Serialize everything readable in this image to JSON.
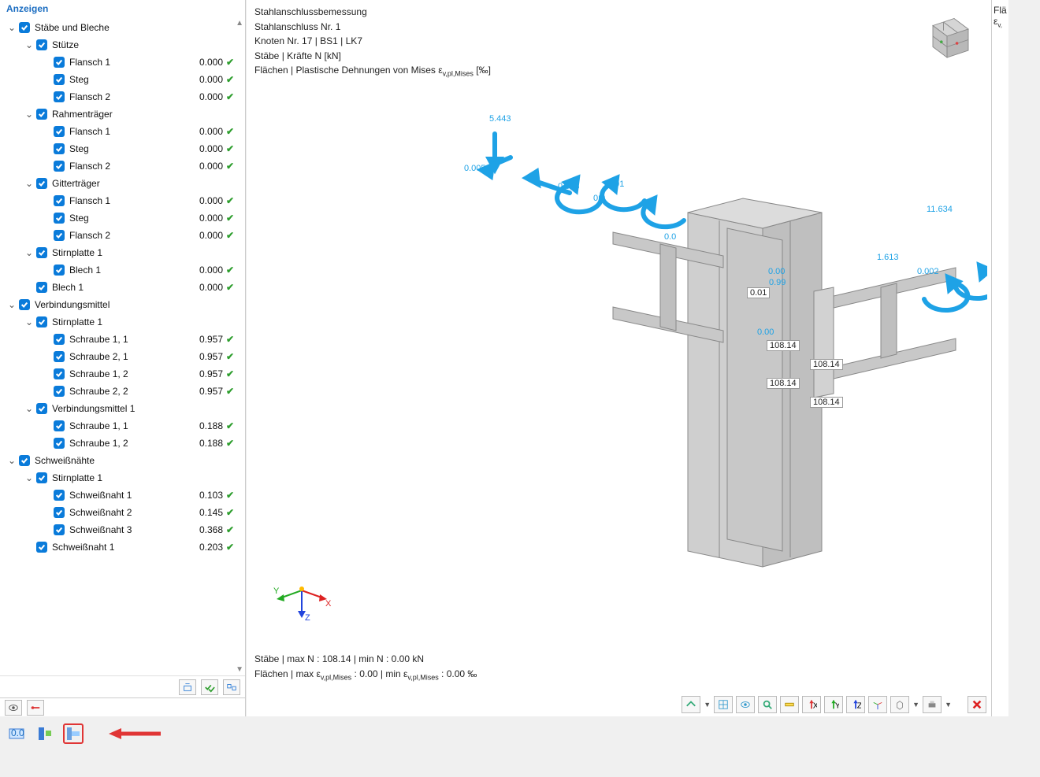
{
  "sidebar": {
    "title": "Anzeigen",
    "toolbar": {
      "btn1": "expand-selected",
      "btn2": "check-all",
      "btn3": "uncheck-all"
    },
    "tabs": {
      "eye": "visibility-tab",
      "line": "filter-tab"
    }
  },
  "tree": {
    "n0": {
      "chev": "⌄",
      "ind": 0,
      "label": "Stäbe und Bleche"
    },
    "n1": {
      "chev": "⌄",
      "ind": 1,
      "label": "Stütze"
    },
    "n2": {
      "ind": 2,
      "label": "Flansch 1",
      "val": "0.000"
    },
    "n3": {
      "ind": 2,
      "label": "Steg",
      "val": "0.000"
    },
    "n4": {
      "ind": 2,
      "label": "Flansch 2",
      "val": "0.000"
    },
    "n5": {
      "chev": "⌄",
      "ind": 1,
      "label": "Rahmenträger"
    },
    "n6": {
      "ind": 2,
      "label": "Flansch 1",
      "val": "0.000"
    },
    "n7": {
      "ind": 2,
      "label": "Steg",
      "val": "0.000"
    },
    "n8": {
      "ind": 2,
      "label": "Flansch 2",
      "val": "0.000"
    },
    "n9": {
      "chev": "⌄",
      "ind": 1,
      "label": "Gitterträger"
    },
    "n10": {
      "ind": 2,
      "label": "Flansch 1",
      "val": "0.000"
    },
    "n11": {
      "ind": 2,
      "label": "Steg",
      "val": "0.000"
    },
    "n12": {
      "ind": 2,
      "label": "Flansch 2",
      "val": "0.000"
    },
    "n13": {
      "chev": "⌄",
      "ind": 1,
      "label": "Stirnplatte 1"
    },
    "n14": {
      "ind": 2,
      "label": "Blech 1",
      "val": "0.000"
    },
    "n15": {
      "ind": 1,
      "label": "Blech 1",
      "val": "0.000"
    },
    "n16": {
      "chev": "⌄",
      "ind": 0,
      "label": "Verbindungsmittel"
    },
    "n17": {
      "chev": "⌄",
      "ind": 1,
      "label": "Stirnplatte 1"
    },
    "n18": {
      "ind": 2,
      "label": "Schraube 1, 1",
      "val": "0.957"
    },
    "n19": {
      "ind": 2,
      "label": "Schraube 2, 1",
      "val": "0.957"
    },
    "n20": {
      "ind": 2,
      "label": "Schraube 1, 2",
      "val": "0.957"
    },
    "n21": {
      "ind": 2,
      "label": "Schraube 2, 2",
      "val": "0.957"
    },
    "n22": {
      "chev": "⌄",
      "ind": 1,
      "label": "Verbindungsmittel 1"
    },
    "n23": {
      "ind": 2,
      "label": "Schraube 1, 1",
      "val": "0.188"
    },
    "n24": {
      "ind": 2,
      "label": "Schraube 1, 2",
      "val": "0.188"
    },
    "n25": {
      "chev": "⌄",
      "ind": 0,
      "label": "Schweißnähte"
    },
    "n26": {
      "chev": "⌄",
      "ind": 1,
      "label": "Stirnplatte 1"
    },
    "n27": {
      "ind": 2,
      "label": "Schweißnaht 1",
      "val": "0.103"
    },
    "n28": {
      "ind": 2,
      "label": "Schweißnaht 2",
      "val": "0.145"
    },
    "n29": {
      "ind": 2,
      "label": "Schweißnaht 3",
      "val": "0.368"
    },
    "n30": {
      "ind": 1,
      "label": "Schweißnaht 1",
      "val": "0.203"
    }
  },
  "viewport": {
    "info1": "Stahlanschlussbemessung",
    "info2": "Stahlanschluss Nr. 1",
    "info3": "Knoten Nr. 17 | BS1 | LK7",
    "info4": "Stäbe | Kräfte N [kN]",
    "info5_a": "Flächen | Plastische Dehnungen von Mises ε",
    "info5_sub": "v,pl,Mises",
    "info5_b": " [‰]",
    "bot1": "Stäbe | max N : 108.14 | min N : 0.00 kN",
    "bot2_a": "Flächen | max ε",
    "bot2_sub": "v,pl,Mises",
    "bot2_b": " : 0.00 | min ε",
    "bot2_c": " : 0.00 ‰",
    "tags": {
      "t1": "0.01",
      "t2": "108.14",
      "t3": "108.14",
      "t4": "108.14",
      "t5": "108.14"
    },
    "forces": {
      "f1": "5.443",
      "f2": "0.005",
      "f3": "0.013",
      "f4": "0.0",
      "f5": "1.91",
      "f6": "0.0",
      "f7": "0.00",
      "f8": "0.99",
      "f9": "0.00",
      "f10": "1.613",
      "f11": "11.634",
      "f12": "0.002"
    },
    "axes": {
      "x": "X",
      "y": "Y",
      "z": "Z"
    }
  },
  "right": {
    "l1": "Flä",
    "l2_a": "ε",
    "l2_sub": "v,"
  },
  "bottom_icons": {
    "b1": "values-icon",
    "b2": "model-icon",
    "b3": "connection-icon"
  }
}
